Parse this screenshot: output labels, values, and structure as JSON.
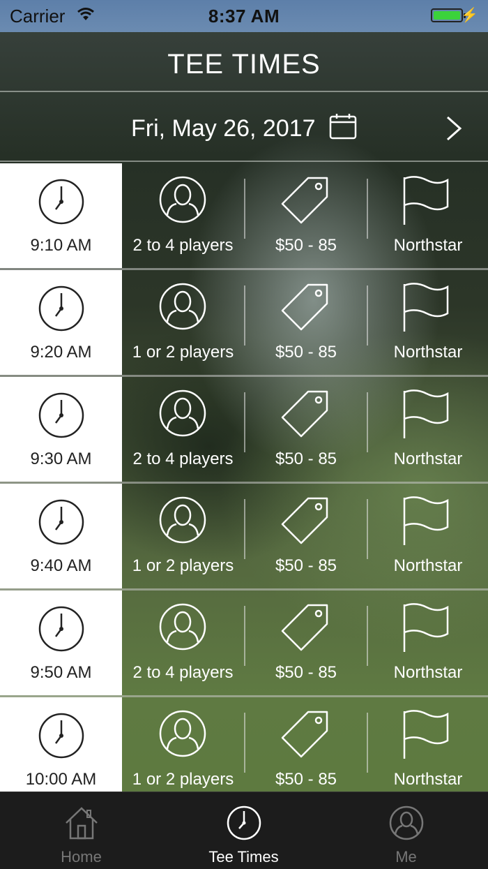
{
  "status_bar": {
    "carrier": "Carrier",
    "time": "8:37 AM"
  },
  "header": {
    "title": "TEE TIMES"
  },
  "date_bar": {
    "date": "Fri, May 26, 2017"
  },
  "tee_times": [
    {
      "time": "9:10 AM",
      "players": "2 to 4 players",
      "price": "$50 - 85",
      "course": "Northstar"
    },
    {
      "time": "9:20 AM",
      "players": "1 or 2 players",
      "price": "$50 - 85",
      "course": "Northstar"
    },
    {
      "time": "9:30 AM",
      "players": "2 to 4 players",
      "price": "$50 - 85",
      "course": "Northstar"
    },
    {
      "time": "9:40 AM",
      "players": "1 or 2 players",
      "price": "$50 - 85",
      "course": "Northstar"
    },
    {
      "time": "9:50 AM",
      "players": "2 to 4 players",
      "price": "$50 - 85",
      "course": "Northstar"
    },
    {
      "time": "10:00 AM",
      "players": "1 or 2 players",
      "price": "$50 - 85",
      "course": "Northstar"
    }
  ],
  "tab_bar": {
    "tabs": [
      {
        "label": "Home",
        "icon": "house-icon",
        "active": false
      },
      {
        "label": "Tee Times",
        "icon": "clock-icon",
        "active": true
      },
      {
        "label": "Me",
        "icon": "person-icon",
        "active": false
      }
    ]
  },
  "colors": {
    "battery": "#3bd23b",
    "status_bar_bg": "#6b8bb1",
    "tab_bar_bg": "#1c1c1c",
    "time_cell_bg": "#ffffff"
  }
}
